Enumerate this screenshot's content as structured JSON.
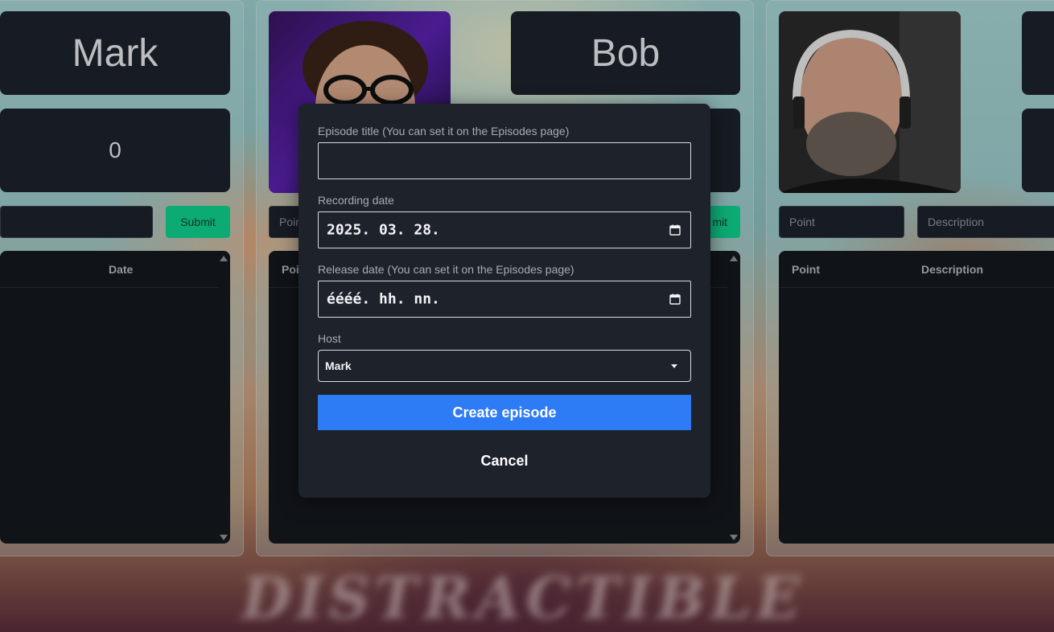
{
  "players": [
    {
      "name": "Mark",
      "score": "0",
      "input_placeholder": "",
      "submit_label": "Submit",
      "table_headers": [
        "Date"
      ]
    },
    {
      "name": "Bob",
      "input_placeholder": "Poir",
      "submit_label": "mit",
      "table_headers": [
        "Poi"
      ]
    },
    {
      "point_placeholder": "Point",
      "description_placeholder": "Description",
      "table_headers": [
        "Point",
        "Description"
      ]
    }
  ],
  "modal": {
    "episode_title_label": "Episode title (You can set it on the Episodes page)",
    "episode_title_value": "",
    "recording_date_label": "Recording date",
    "recording_date_value": "2025. 03. 28.",
    "release_date_label": "Release date (You can set it on the Episodes page)",
    "release_date_value": "éééé. hh. nn.",
    "host_label": "Host",
    "host_value": "Mark",
    "create_button": "Create episode",
    "cancel_button": "Cancel"
  },
  "colors": {
    "panel": "#1d222b",
    "table_bg": "#14181e",
    "submit": "#10d18e",
    "primary": "#2e7bf6"
  },
  "icons": [
    "calendar-icon",
    "calendar-icon",
    "caret-down-icon",
    "scroll-up-arrow",
    "scroll-down-arrow"
  ]
}
